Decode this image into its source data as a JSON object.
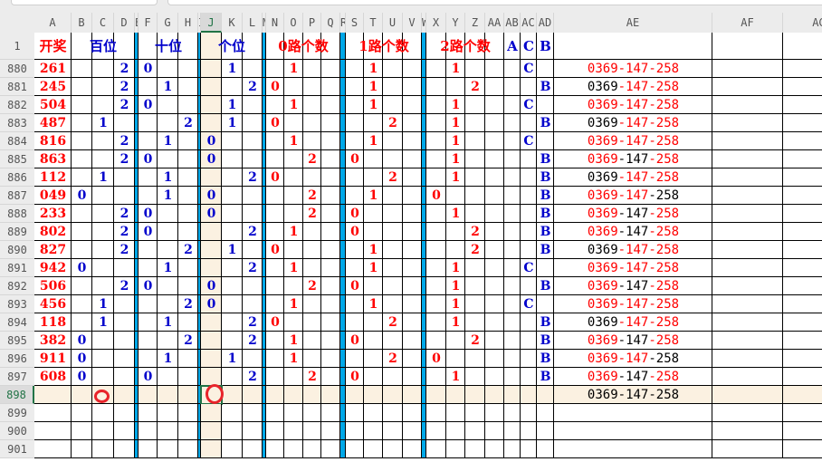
{
  "columns": [
    "A",
    "B",
    "C",
    "D",
    "E",
    "F",
    "G",
    "H",
    "I",
    "J",
    "K",
    "L",
    "M",
    "N",
    "O",
    "P",
    "Q",
    "R",
    "S",
    "T",
    "U",
    "V",
    "W",
    "X",
    "Y",
    "Z",
    "AA",
    "AB",
    "AC",
    "AD",
    "AE",
    "AF",
    "AG"
  ],
  "header_row": {
    "row_number": "1",
    "draw": "开奖",
    "hundreds": "百位",
    "tens": "十位",
    "units": "个位",
    "route0": "0路个数",
    "route1": "1路个数",
    "route2": "2路个数",
    "ab": "A",
    "ac": "C",
    "ad": "B"
  },
  "ae_segments": [
    "0369",
    "-147",
    "-258"
  ],
  "colors": {
    "red": "#ff0000",
    "blue": "#0000cc",
    "separator": "#00a8e8",
    "selected": "#217346"
  },
  "selected_cell": "J898",
  "rows": [
    {
      "row": "880",
      "n": "261",
      "bai": "2",
      "shi": "0",
      "ge": "1",
      "l0": "1",
      "l1": "1",
      "l2": "1",
      "t": "C",
      "ae": [
        1,
        1,
        1
      ]
    },
    {
      "row": "881",
      "n": "245",
      "bai": "2",
      "shi": "1",
      "ge": "2",
      "l0": "0",
      "l1": "1",
      "l2": "2",
      "t": "B",
      "ae": [
        0,
        1,
        1
      ]
    },
    {
      "row": "882",
      "n": "504",
      "bai": "2",
      "shi": "0",
      "ge": "1",
      "l0": "1",
      "l1": "1",
      "l2": "1",
      "t": "C",
      "ae": [
        1,
        1,
        1
      ]
    },
    {
      "row": "883",
      "n": "487",
      "bai": "1",
      "shi": "2",
      "ge": "1",
      "l0": "0",
      "l1": "2",
      "l2": "1",
      "t": "B",
      "ae": [
        0,
        1,
        1
      ]
    },
    {
      "row": "884",
      "n": "816",
      "bai": "2",
      "shi": "1",
      "ge": "0",
      "l0": "1",
      "l1": "1",
      "l2": "1",
      "t": "C",
      "ae": [
        1,
        1,
        1
      ]
    },
    {
      "row": "885",
      "n": "863",
      "bai": "2",
      "shi": "0",
      "ge": "0",
      "l0": "2",
      "l1": "0",
      "l2": "1",
      "t": "B",
      "ae": [
        1,
        0,
        1
      ]
    },
    {
      "row": "886",
      "n": "112",
      "bai": "1",
      "shi": "1",
      "ge": "2",
      "l0": "0",
      "l1": "2",
      "l2": "1",
      "t": "B",
      "ae": [
        0,
        1,
        1
      ]
    },
    {
      "row": "887",
      "n": "049",
      "bai": "0",
      "shi": "1",
      "ge": "0",
      "l0": "2",
      "l1": "1",
      "l2": "0",
      "t": "B",
      "ae": [
        1,
        1,
        0
      ]
    },
    {
      "row": "888",
      "n": "233",
      "bai": "2",
      "shi": "0",
      "ge": "0",
      "l0": "2",
      "l1": "0",
      "l2": "1",
      "t": "B",
      "ae": [
        1,
        0,
        1
      ]
    },
    {
      "row": "889",
      "n": "802",
      "bai": "2",
      "shi": "0",
      "ge": "2",
      "l0": "1",
      "l1": "0",
      "l2": "2",
      "t": "B",
      "ae": [
        1,
        0,
        1
      ]
    },
    {
      "row": "890",
      "n": "827",
      "bai": "2",
      "shi": "2",
      "ge": "1",
      "l0": "0",
      "l1": "1",
      "l2": "2",
      "t": "B",
      "ae": [
        0,
        1,
        1
      ]
    },
    {
      "row": "891",
      "n": "942",
      "bai": "0",
      "shi": "1",
      "ge": "2",
      "l0": "1",
      "l1": "1",
      "l2": "1",
      "t": "C",
      "ae": [
        1,
        1,
        1
      ]
    },
    {
      "row": "892",
      "n": "506",
      "bai": "2",
      "shi": "0",
      "ge": "0",
      "l0": "2",
      "l1": "0",
      "l2": "1",
      "t": "B",
      "ae": [
        1,
        0,
        1
      ]
    },
    {
      "row": "893",
      "n": "456",
      "bai": "1",
      "shi": "2",
      "ge": "0",
      "l0": "1",
      "l1": "1",
      "l2": "1",
      "t": "C",
      "ae": [
        1,
        1,
        1
      ]
    },
    {
      "row": "894",
      "n": "118",
      "bai": "1",
      "shi": "1",
      "ge": "2",
      "l0": "0",
      "l1": "2",
      "l2": "1",
      "t": "B",
      "ae": [
        0,
        1,
        1
      ]
    },
    {
      "row": "895",
      "n": "382",
      "bai": "0",
      "shi": "2",
      "ge": "2",
      "l0": "1",
      "l1": "0",
      "l2": "2",
      "t": "B",
      "ae": [
        1,
        0,
        1
      ]
    },
    {
      "row": "896",
      "n": "911",
      "bai": "0",
      "shi": "1",
      "ge": "1",
      "l0": "1",
      "l1": "2",
      "l2": "0",
      "t": "B",
      "ae": [
        1,
        1,
        0
      ]
    },
    {
      "row": "897",
      "n": "608",
      "bai": "0",
      "shi": "0",
      "ge": "2",
      "l0": "2",
      "l1": "0",
      "l2": "1",
      "t": "B",
      "ae": [
        1,
        0,
        1
      ]
    },
    {
      "row": "898",
      "n": "",
      "bai": "",
      "shi": "",
      "ge": "",
      "l0": "",
      "l1": "",
      "l2": "",
      "t": "",
      "ae": [
        0,
        0,
        0
      ]
    }
  ],
  "empty_rows": [
    "899",
    "900",
    "901"
  ]
}
